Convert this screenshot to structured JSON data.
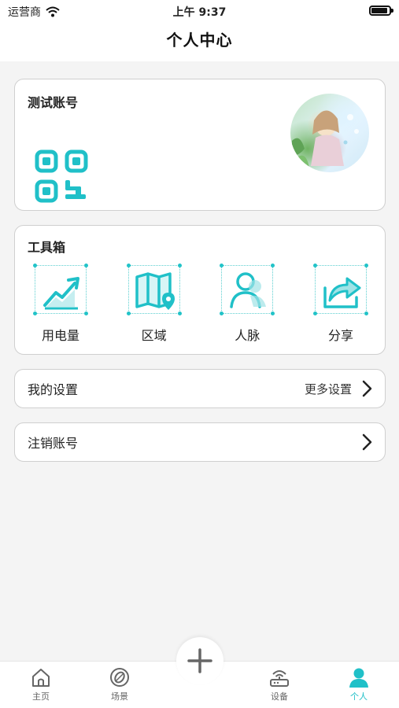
{
  "status_bar": {
    "carrier": "运营商",
    "time": "上午 9:37"
  },
  "nav": {
    "title": "个人中心"
  },
  "account": {
    "name": "测试账号"
  },
  "toolbox": {
    "title": "工具箱",
    "items": [
      {
        "label": "用电量",
        "icon": "power-usage-chart-icon"
      },
      {
        "label": "区域",
        "icon": "map-area-icon"
      },
      {
        "label": "人脉",
        "icon": "contacts-icon"
      },
      {
        "label": "分享",
        "icon": "share-icon"
      }
    ]
  },
  "settings": {
    "label": "我的设置",
    "more": "更多设置"
  },
  "logout": {
    "label": "注销账号"
  },
  "tabs": [
    {
      "label": "主页",
      "icon": "home-icon"
    },
    {
      "label": "场景",
      "icon": "scene-icon"
    },
    {
      "label": "设备",
      "icon": "router-icon"
    },
    {
      "label": "个人",
      "icon": "person-icon",
      "active": true
    }
  ],
  "colors": {
    "accent": "#20c0c8",
    "background": "#f4f4f4",
    "card": "#ffffff"
  }
}
